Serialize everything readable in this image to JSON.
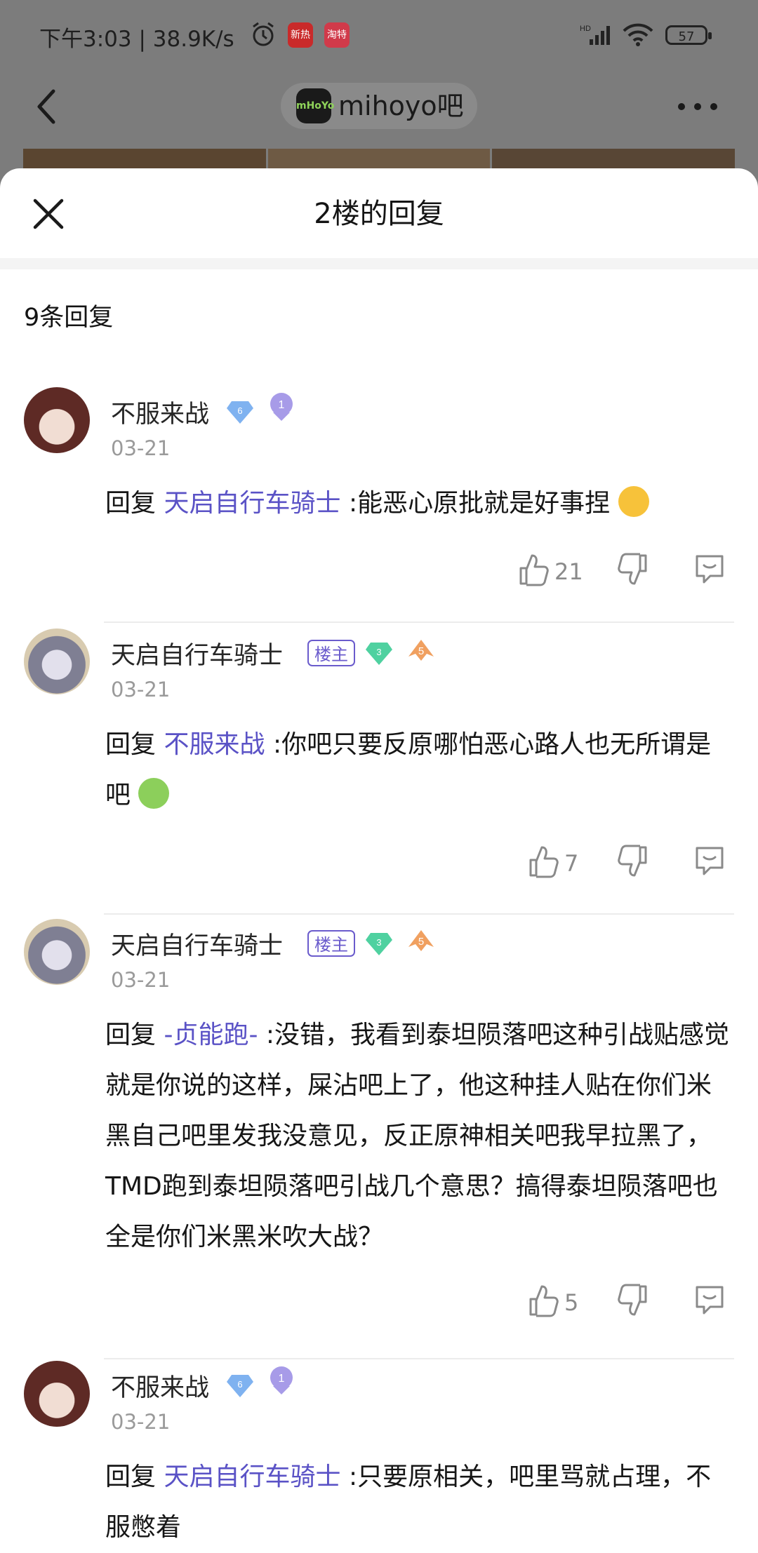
{
  "status_bar": {
    "time_text": "下午3:03 | 38.9K/s",
    "app_icon_1": "新热",
    "app_icon_2": "淘特",
    "battery": "57"
  },
  "nav": {
    "logo_text": "mHoYo",
    "forum_title": "mihoyo吧"
  },
  "sheet": {
    "title": "2楼的回复",
    "reply_count": "9条回复"
  },
  "comments": [
    {
      "username": "不服来战",
      "gem_level": "6",
      "user_level": "1",
      "date": "03-21",
      "reply_prefix": "回复",
      "mention": "天启自行车骑士",
      "text": ":能恶心原批就是好事捏",
      "emoji": "yum-emoji",
      "likes": "21"
    },
    {
      "username": "天启自行车骑士",
      "badge": "楼主",
      "gem_level": "3",
      "user_level": "5",
      "date": "03-21",
      "reply_prefix": "回复",
      "mention": "不服来战",
      "text": ":你吧只要反原哪怕恶心路人也无所谓是吧",
      "emoji": "sick-emoji",
      "likes": "7"
    },
    {
      "username": "天启自行车骑士",
      "badge": "楼主",
      "gem_level": "3",
      "user_level": "5",
      "date": "03-21",
      "reply_prefix": "回复",
      "mention": "-贞能跑-",
      "text": ":没错，我看到泰坦陨落吧这种引战贴感觉就是你说的这样，屎沾吧上了，他这种挂人贴在你们米黑自己吧里发我没意见，反正原神相关吧我早拉黑了，TMD跑到泰坦陨落吧引战几个意思？搞得泰坦陨落吧也全是你们米黑米吹大战？",
      "likes": "5"
    },
    {
      "username": "不服来战",
      "gem_level": "6",
      "user_level": "1",
      "date": "03-21",
      "reply_prefix": "回复",
      "mention": "天启自行车骑士",
      "text": ":只要原相关，吧里骂就占理，不服憋着"
    }
  ],
  "colors": {
    "accent": "#5a52c6",
    "overlay": "#7c7c7c",
    "muted": "#9a9a9a"
  }
}
